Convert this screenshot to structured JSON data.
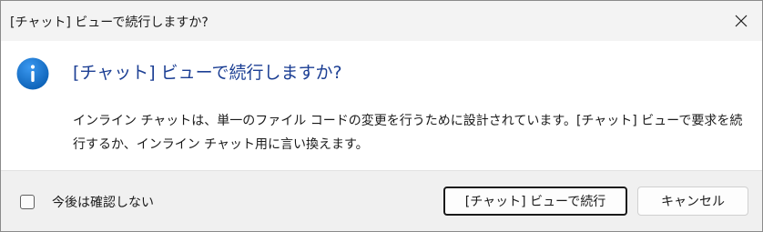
{
  "window": {
    "title": "[チャット] ビューで続行しますか?"
  },
  "dialog": {
    "icon": "info-icon",
    "heading": "[チャット] ビューで続行しますか?",
    "body": "インライン チャットは、単一のファイル コードの変更を行うために設計されています。[チャット] ビューで要求を続行するか、インライン チャット用に言い換えます。",
    "checkbox_label": "今後は確認しない",
    "checkbox_checked": false,
    "primary_button": "[チャット] ビューで続行",
    "cancel_button": "キャンセル"
  },
  "colors": {
    "accent": "#0f6cbd",
    "heading": "#1c3f94"
  }
}
